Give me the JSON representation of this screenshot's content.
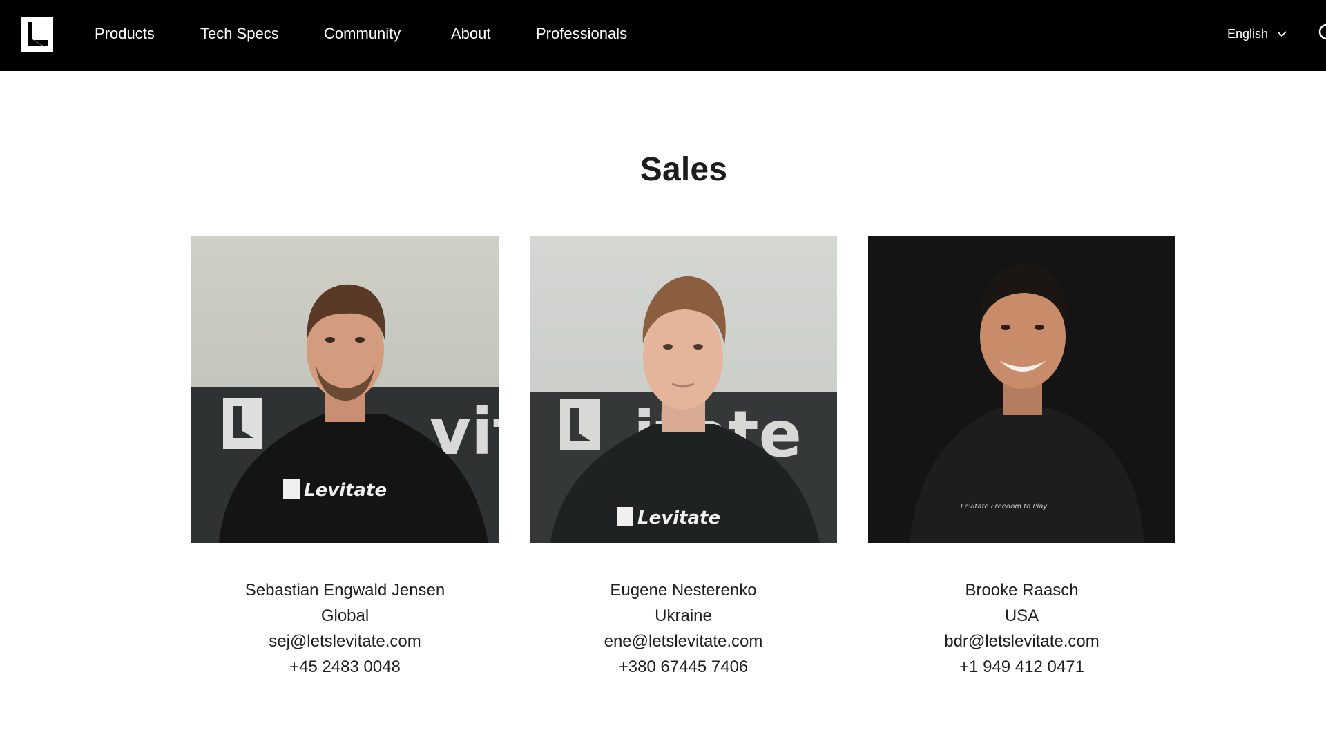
{
  "nav": {
    "items": [
      "Products",
      "Tech Specs",
      "Community",
      "About",
      "Professionals"
    ],
    "language": "English",
    "icons": {
      "logo": "levitate-logo-icon",
      "language_chevron": "chevron-down-icon",
      "search": "search-icon"
    }
  },
  "sales": {
    "title": "Sales",
    "people": [
      {
        "name": "Sebastian Engwald Jensen",
        "region": "Global",
        "email": "sej@letslevitate.com",
        "phone": "+45 2483 0048",
        "shirt_text": "Levitate",
        "backdrop_text": "vit"
      },
      {
        "name": "Eugene Nesterenko",
        "region": "Ukraine",
        "email": "ene@letslevitate.com",
        "phone": "+380 67445 7406",
        "shirt_text": "Levitate",
        "backdrop_text": "itate"
      },
      {
        "name": "Brooke Raasch",
        "region": "USA",
        "email": "bdr@letslevitate.com",
        "phone": "+1 949 412 0471",
        "shirt_text": "Levitate  Freedom to Play"
      }
    ]
  },
  "colors": {
    "nav_bg": "#000000",
    "page_bg": "#ffffff",
    "text": "#1e1e1e"
  }
}
